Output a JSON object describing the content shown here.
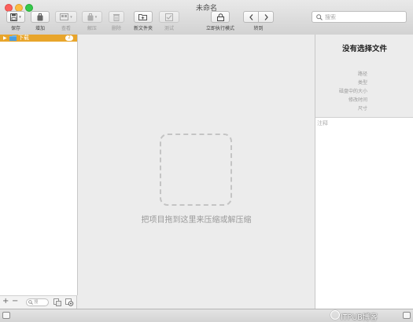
{
  "window": {
    "title": "未命名"
  },
  "toolbar": {
    "save": "保存",
    "add": "增加",
    "view": "查看",
    "extract": "解压",
    "delete": "删除",
    "new_folder": "新文件夹",
    "test": "测试",
    "run_now": "立即执行模式",
    "goto": "转到"
  },
  "search": {
    "placeholder": "搜索"
  },
  "sidebar": {
    "items": [
      {
        "label": "下载",
        "badge": "2"
      }
    ],
    "filter_placeholder": "搜"
  },
  "main": {
    "drop_hint": "把项目拖到这里来压缩或解压缩"
  },
  "info": {
    "title": "没有选择文件",
    "fields": [
      "路径",
      "类型",
      "磁盘中的大小",
      "修改时间",
      "尺寸"
    ],
    "notes_placeholder": "注释"
  },
  "watermark": "ITPUB博客",
  "colors": {
    "accent": "#e8a52b",
    "close": "#fc605c",
    "minimize": "#fdbc40",
    "maximize": "#34c84a"
  }
}
